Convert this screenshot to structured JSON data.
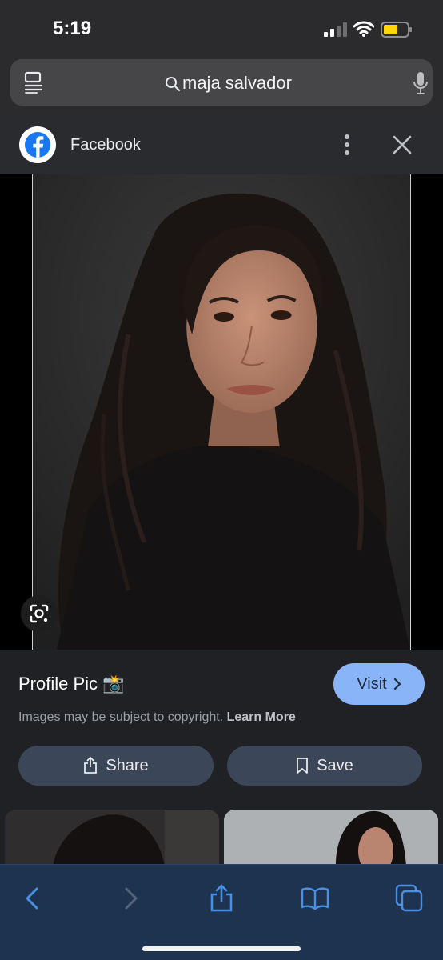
{
  "status_bar": {
    "time": "5:19"
  },
  "search": {
    "query": "maja salvador"
  },
  "source": {
    "name": "Facebook"
  },
  "result": {
    "title": "Profile Pic 📸",
    "visit_label": "Visit",
    "copyright_text": "Images may be subject to copyright.",
    "learn_more_label": "Learn More",
    "share_label": "Share",
    "save_label": "Save"
  },
  "colors": {
    "accent": "#8ab4f8",
    "toolbar_bg": "#1e3350",
    "toolbar_icon": "#4a90e2",
    "button_bg": "#3c4659"
  },
  "icons": [
    "reader-icon",
    "search-icon",
    "mic-icon",
    "facebook-logo-icon",
    "more-vert-icon",
    "close-icon",
    "lens-icon",
    "chevron-right-icon",
    "share-icon",
    "bookmark-icon",
    "back-icon",
    "forward-icon",
    "book-icon",
    "tabs-icon"
  ]
}
